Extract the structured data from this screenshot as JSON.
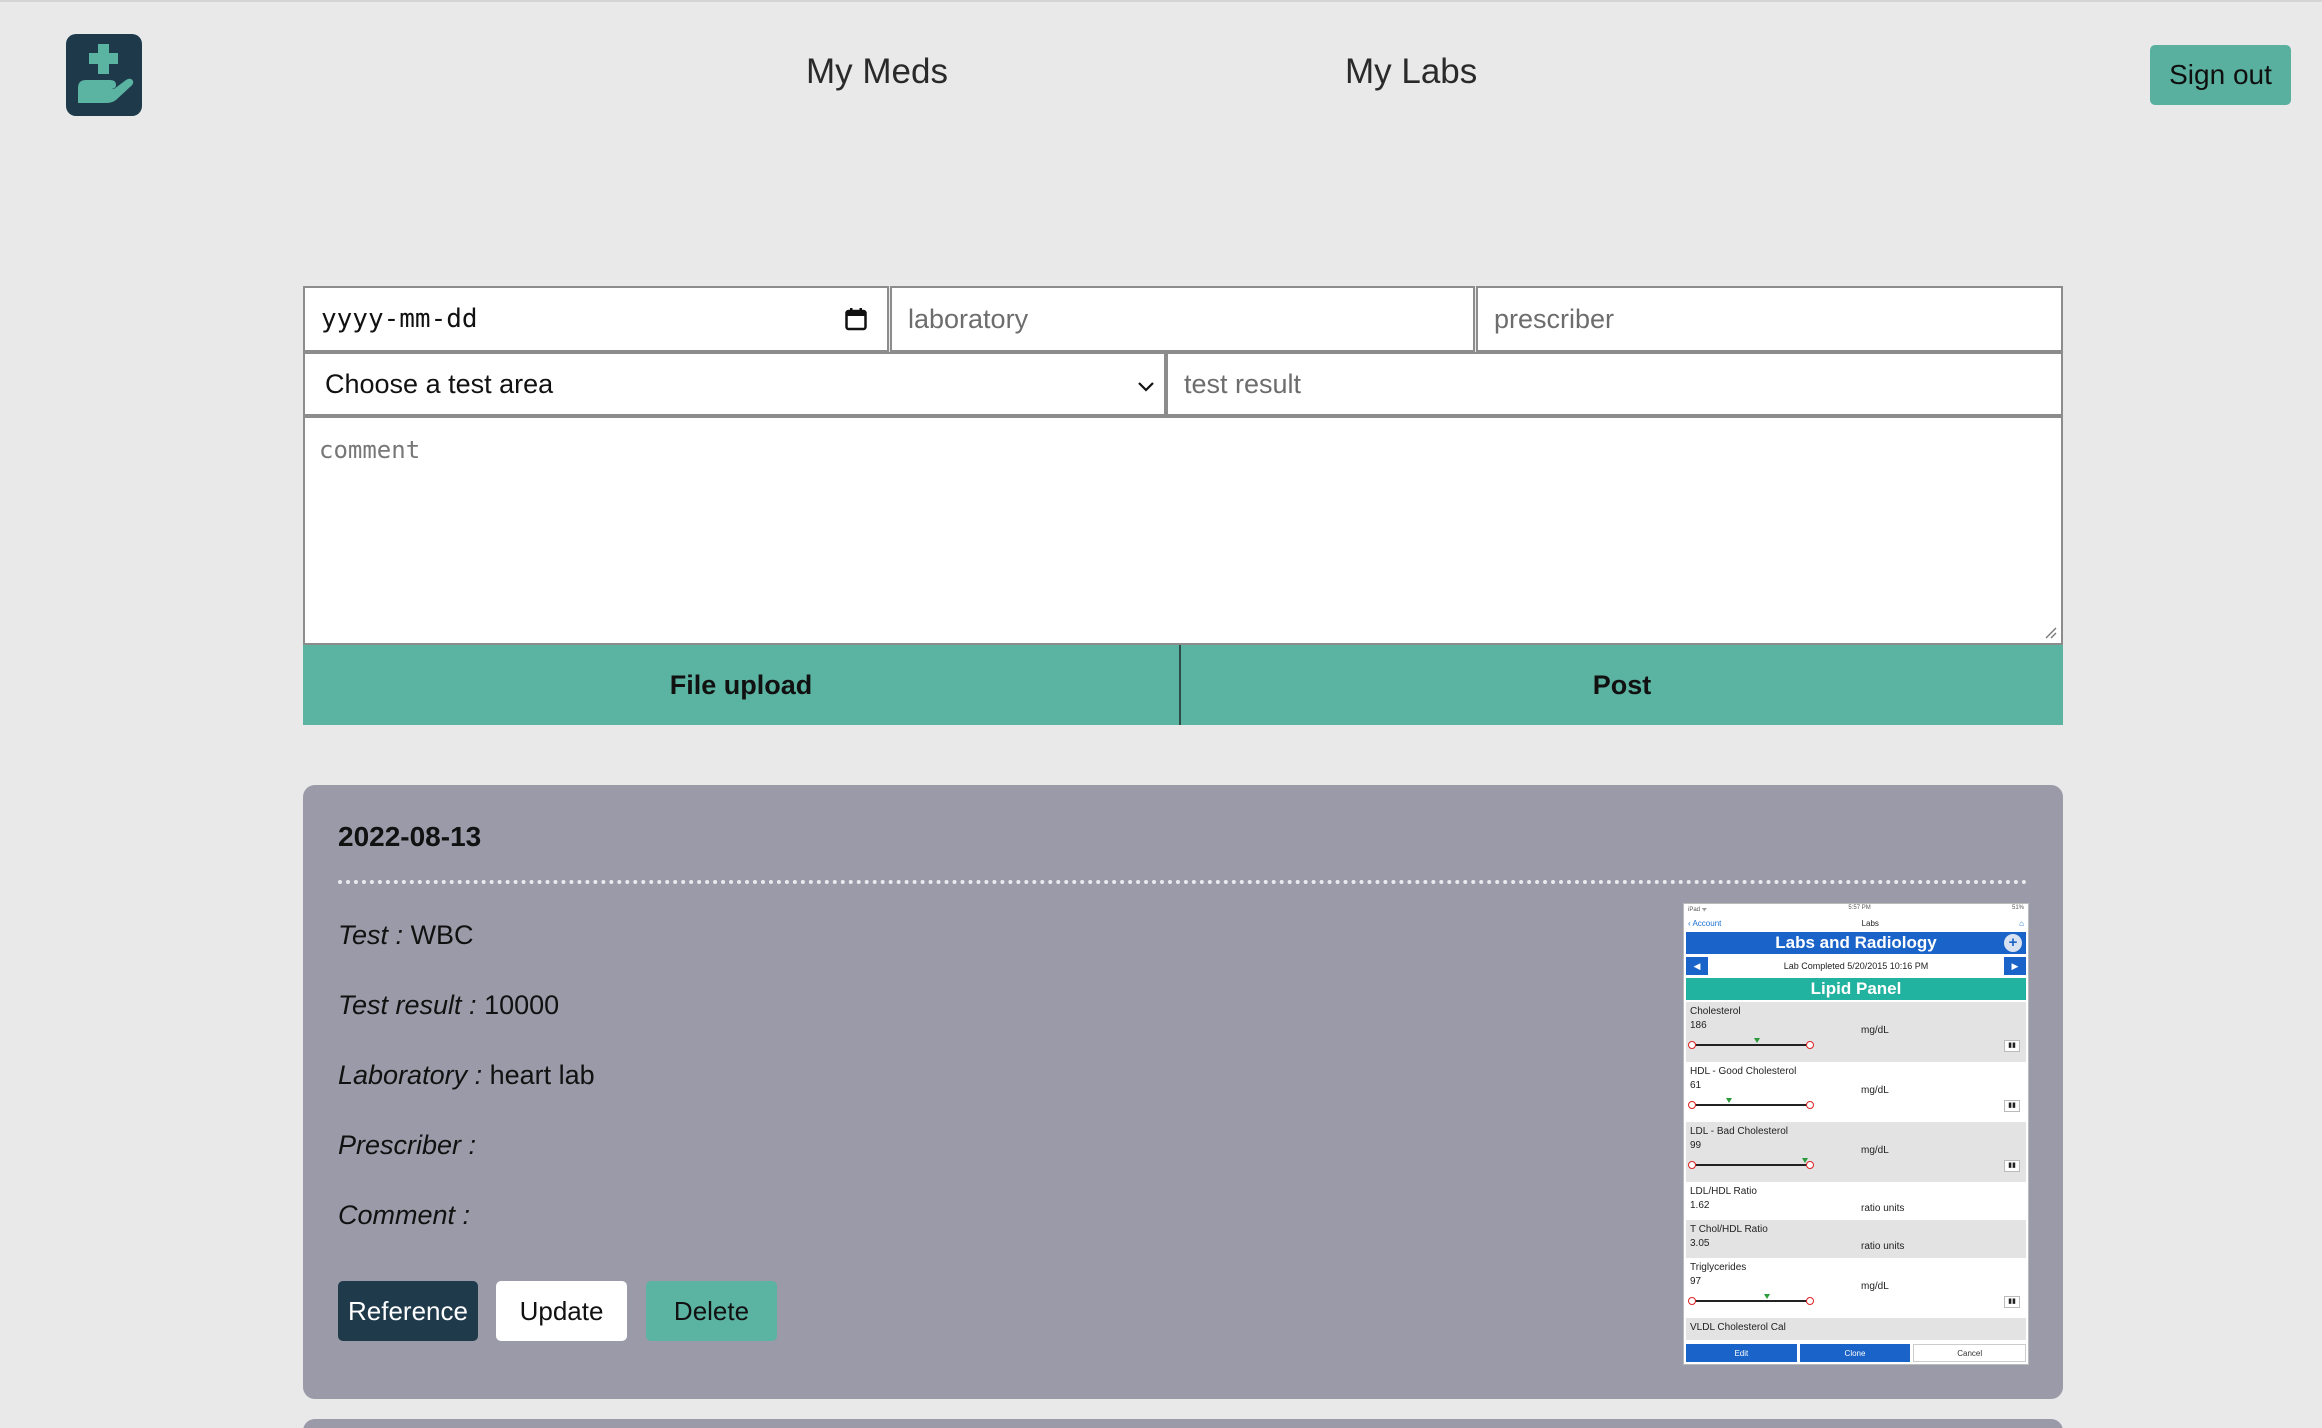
{
  "header": {
    "nav": [
      "My Meds",
      "My Labs"
    ],
    "signout_label": "Sign out",
    "logo_icon": "hand-plus-icon",
    "colors": {
      "logo_bg": "#1e3a4a",
      "accent": "#59b09f"
    }
  },
  "form": {
    "date_placeholder": "yyyy-mm-dd",
    "laboratory_placeholder": "laboratory",
    "prescriber_placeholder": "prescriber",
    "test_area_selected": "Choose a test area",
    "test_result_placeholder": "test result",
    "comment_placeholder": "comment",
    "upload_label": "File upload",
    "post_label": "Post"
  },
  "card": {
    "date": "2022-08-13",
    "test_key": "Test :",
    "test_val": "WBC",
    "result_key": "Test result :",
    "result_val": "10000",
    "lab_key": "Laboratory :",
    "lab_val": "heart lab",
    "prescriber_key": "Prescriber :",
    "prescriber_val": "",
    "comment_key": "Comment :",
    "comment_val": "",
    "reference_label": "Reference",
    "update_label": "Update",
    "delete_label": "Delete"
  },
  "thumbnail": {
    "status_left": "iPad ᯤ",
    "status_mid": "5:57 PM",
    "status_right": "51%",
    "back": "Account",
    "nav_title": "Labs",
    "title": "Labs and Radiology",
    "completed": "Lab Completed 5/20/2015 10:16 PM",
    "panel": "Lipid Panel",
    "items": [
      {
        "name": "Cholesterol",
        "value": "186",
        "unit": "mg/dL"
      },
      {
        "name": "HDL - Good Cholesterol",
        "value": "61",
        "unit": "mg/dL"
      },
      {
        "name": "LDL - Bad Cholesterol",
        "value": "99",
        "unit": "mg/dL"
      },
      {
        "name": "LDL/HDL Ratio",
        "value": "1.62",
        "unit": "ratio units"
      },
      {
        "name": "T Chol/HDL Ratio",
        "value": "3.05",
        "unit": "ratio units"
      },
      {
        "name": "Triglycerides",
        "value": "97",
        "unit": "mg/dL"
      },
      {
        "name": "VLDL Cholesterol Cal",
        "value": "",
        "unit": ""
      }
    ],
    "footer": [
      "Edit",
      "Clone",
      "Cancel"
    ]
  }
}
